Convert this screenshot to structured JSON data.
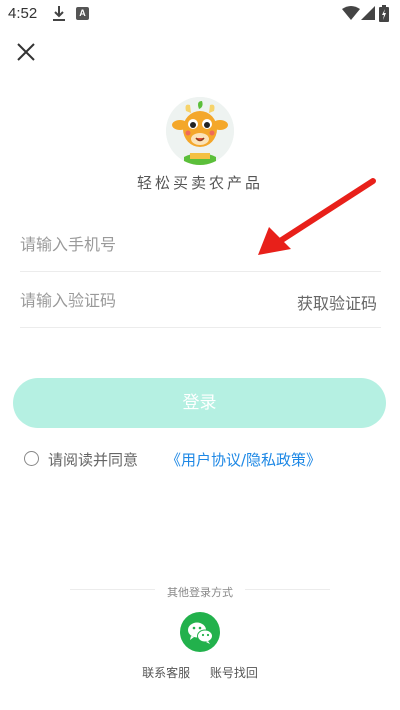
{
  "status_bar": {
    "time": "4:52",
    "badge": "A"
  },
  "header": {
    "close_icon": "close-icon"
  },
  "logo": {
    "icon": "cow-mascot-logo"
  },
  "slogan": "轻松买卖农产品",
  "phone_field": {
    "placeholder": "请输入手机号",
    "value": ""
  },
  "code_field": {
    "placeholder": "请输入验证码",
    "value": "",
    "get_code_label": "获取验证码"
  },
  "login_button": {
    "label": "登录"
  },
  "agreement": {
    "text": "请阅读并同意",
    "link": "《用户协议/隐私政策》"
  },
  "other_login": {
    "label": "其他登录方式",
    "wechat_icon": "wechat-icon"
  },
  "bottom_links": {
    "contact": "联系客服",
    "recover": "账号找回"
  },
  "colors": {
    "accent_disabled": "#b5f0e2",
    "link": "#1e88e5",
    "wechat": "#22b14c",
    "annotation_arrow": "#e8201a"
  }
}
